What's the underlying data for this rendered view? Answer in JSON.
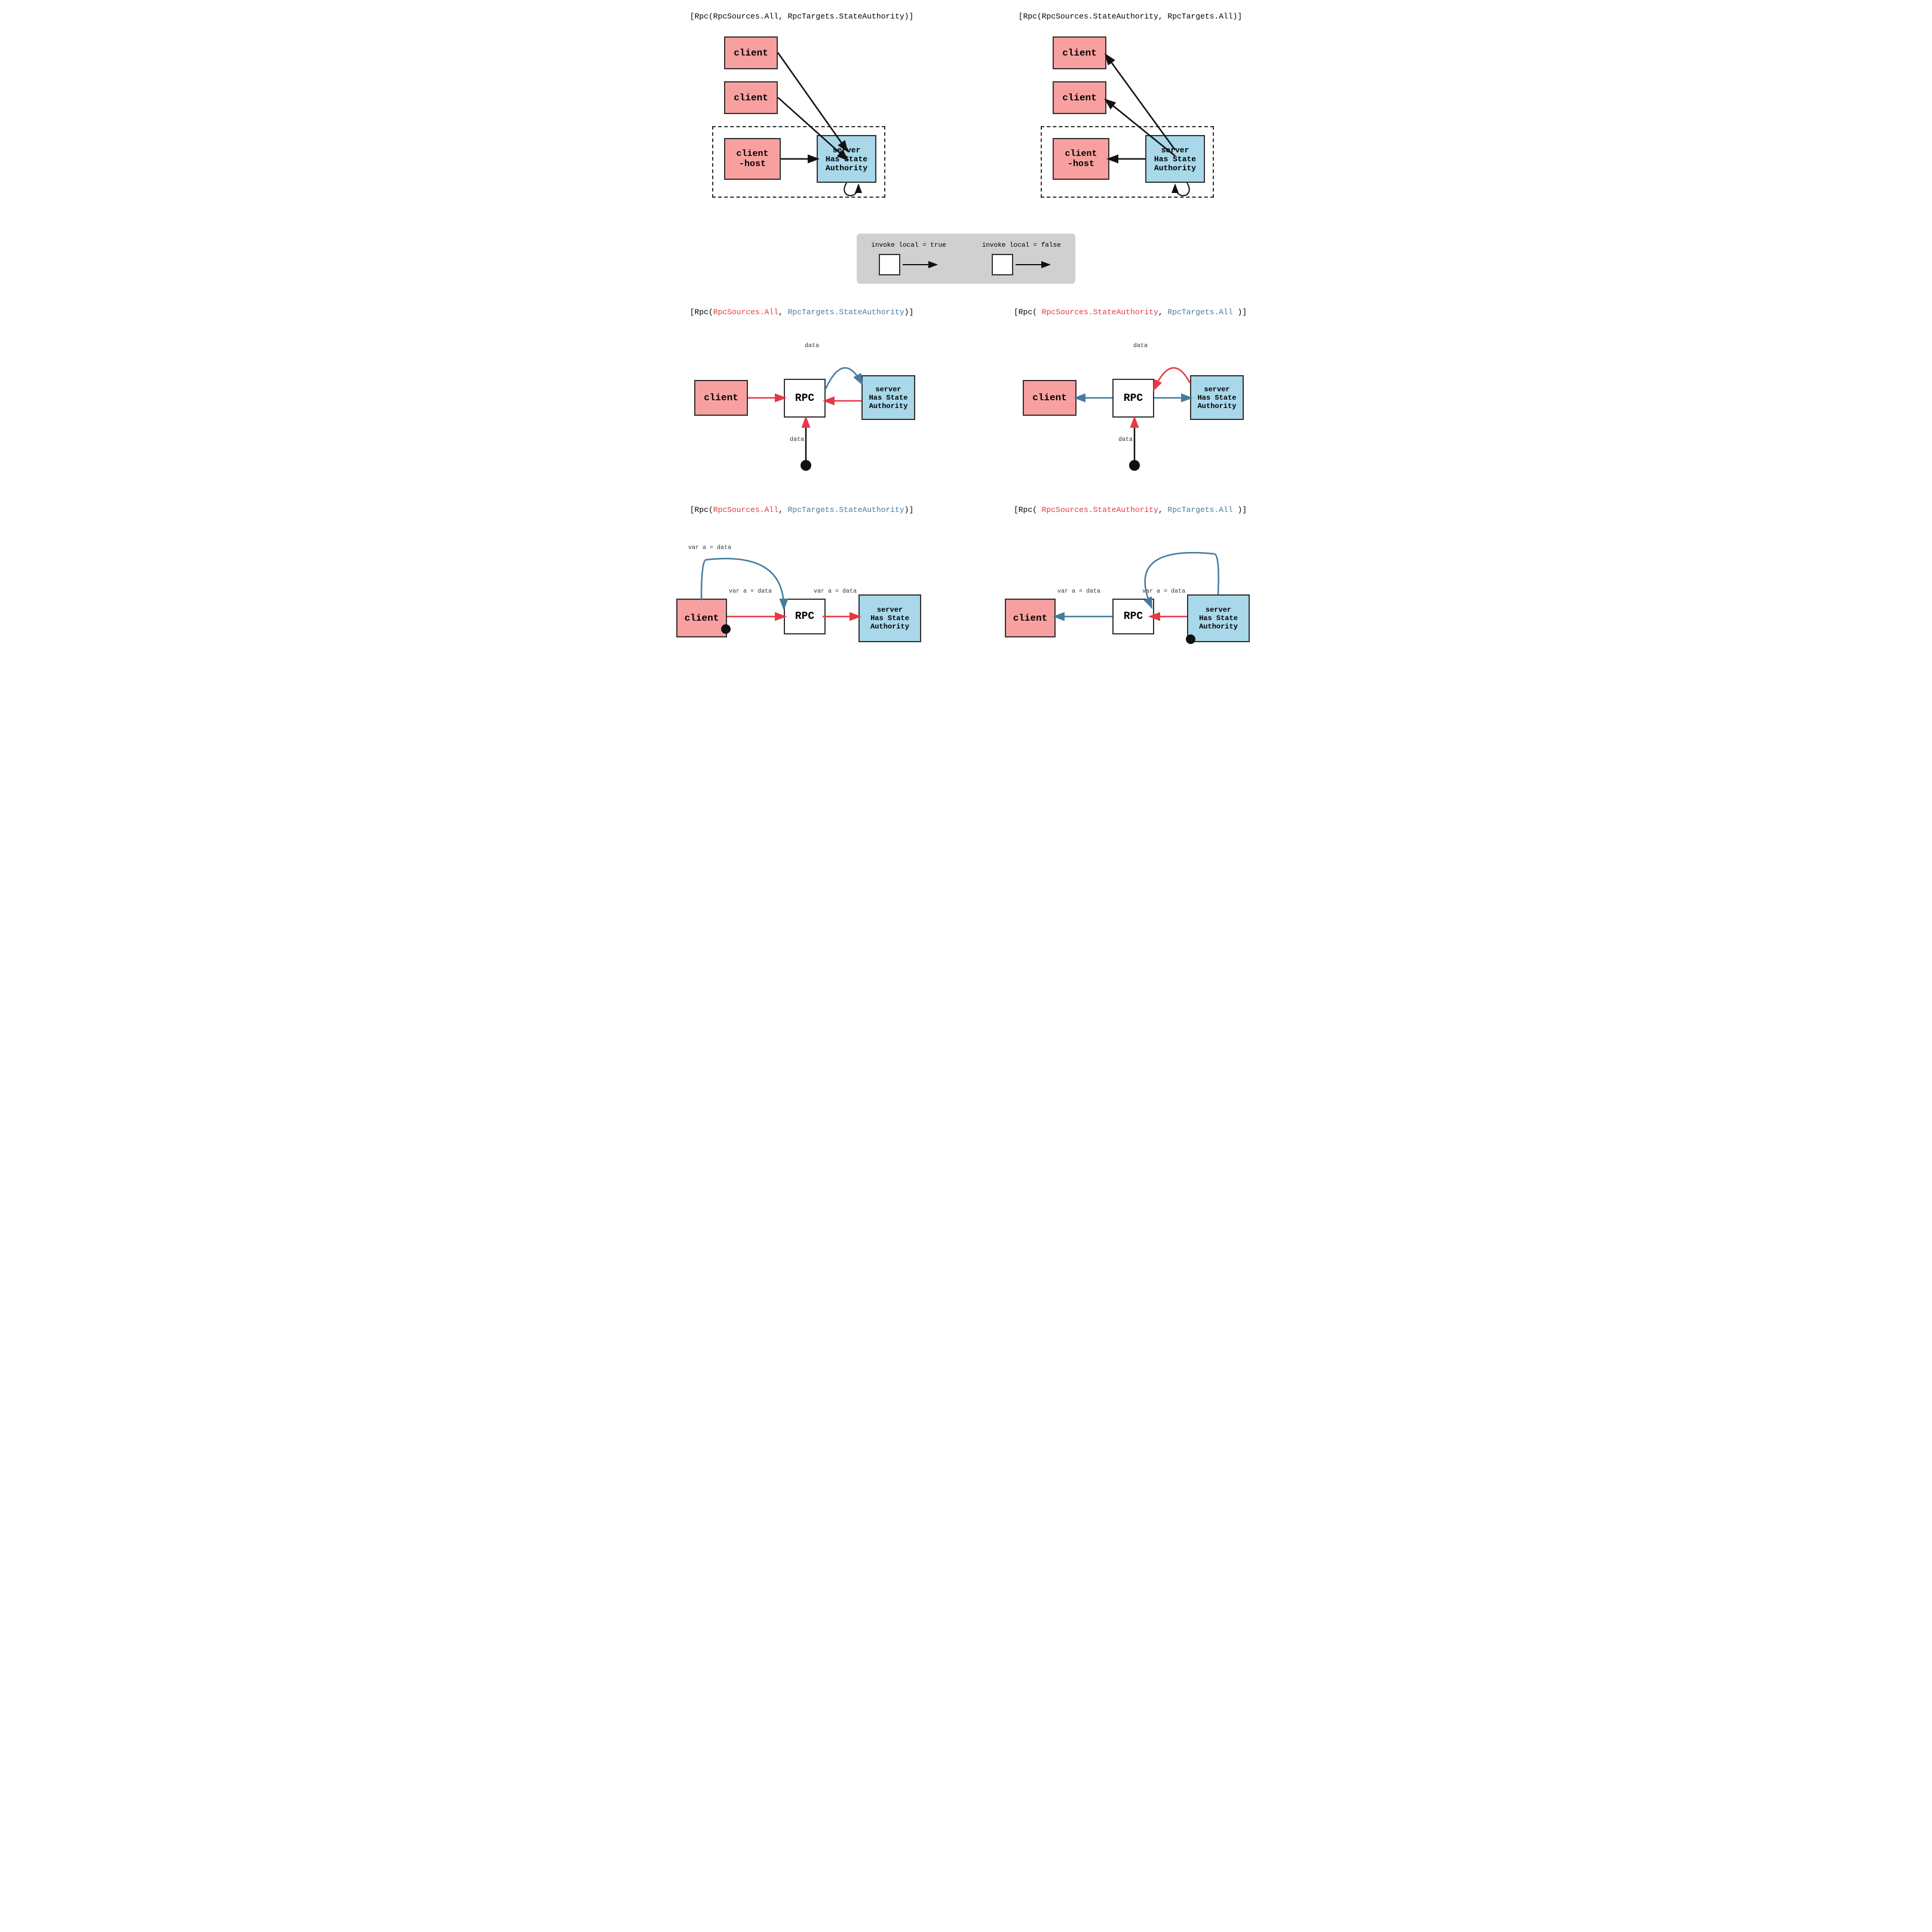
{
  "sections": {
    "s1_left_label": "[Rpc(RpcSources.All, RpcTargets.StateAuthority)]",
    "s1_right_label": "[Rpc(RpcSources.StateAuthority, RpcTargets.All)]",
    "s2_left_label_plain": "[Rpc(",
    "s2_left_red": "RpcSources.All",
    "s2_left_comma": ", ",
    "s2_left_blue": "RpcTargets.StateAuthority",
    "s2_left_close": ")]",
    "s2_right_label_plain": "[Rpc( ",
    "s2_right_red": "RpcSources.StateAuthority",
    "s2_right_comma2": ", ",
    "s2_right_blue": "RpcTargets.All",
    "s2_right_close": " )]",
    "s3_left_label_open": "[Rpc(",
    "s3_left_red": "RpcSources.All",
    "s3_left_blue": "RpcTargets.StateAuthority",
    "s3_left_close": ")]",
    "s3_right_label_open": "[Rpc( ",
    "s3_right_red": "RpcSources.StateAuthority",
    "s3_right_blue": "RpcTargets.All",
    "s3_right_close": " )]"
  },
  "boxes": {
    "client": "client",
    "client_host": "client\n-host",
    "server_authority": "server\nHas State\nAuthority",
    "rpc": "RPC"
  },
  "legend": {
    "invoke_true": "invoke local = true",
    "invoke_false": "invoke local = false"
  },
  "labels": {
    "data": "data",
    "var_a_data": "var a = data"
  }
}
